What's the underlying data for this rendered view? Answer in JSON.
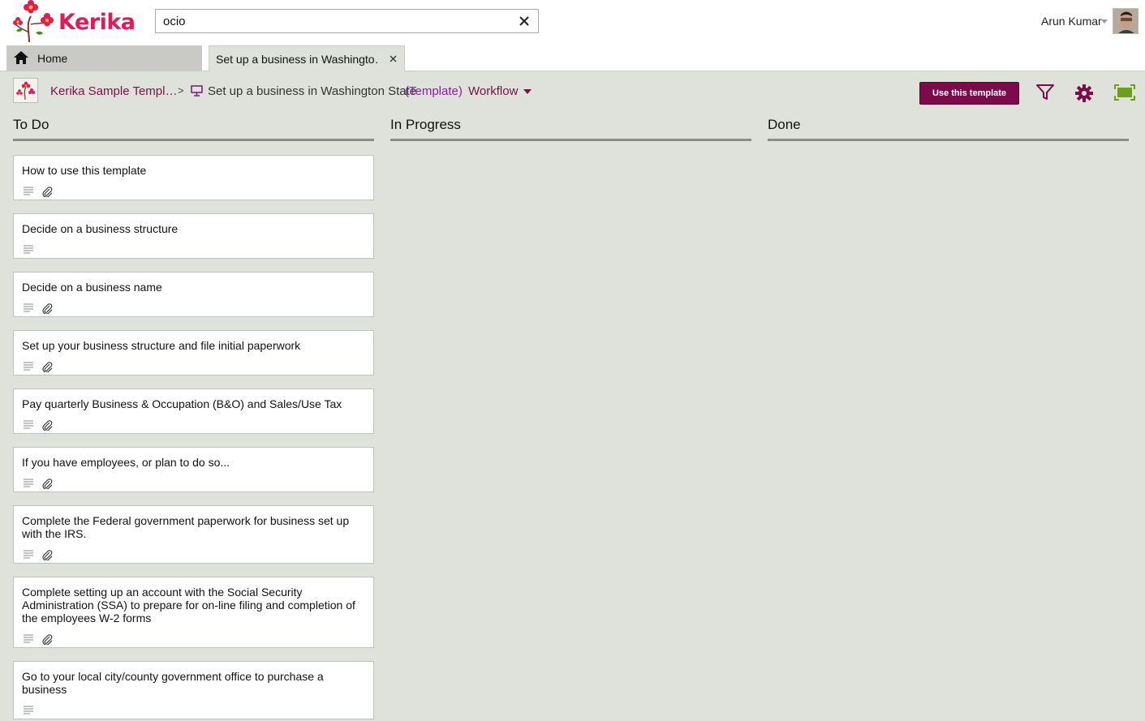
{
  "app": {
    "brand": "Kerika",
    "brand_color": "#e3195a",
    "accent": "#7d0a4b"
  },
  "search": {
    "value": "ocio",
    "placeholder": ""
  },
  "user": {
    "name": "Arun Kumar"
  },
  "tabs": [
    {
      "label": "Home",
      "icon": "home-icon"
    },
    {
      "label": "Set up a business in Washingto…",
      "icon": "close-icon"
    }
  ],
  "breadcrumb": {
    "project": "Kerika Sample Templ…",
    "separator": ">",
    "board": "Set up a business in Washington State",
    "tag": "(Template)",
    "view": "Workflow"
  },
  "toolbar": {
    "use_template_label": "Use this template"
  },
  "columns": [
    {
      "title": "To Do"
    },
    {
      "title": "In Progress"
    },
    {
      "title": "Done"
    }
  ],
  "cards": [
    {
      "title": "How to use this template",
      "has_description": true,
      "has_attachment": true
    },
    {
      "title": "Decide on a business structure",
      "has_description": true,
      "has_attachment": false
    },
    {
      "title": "Decide on a business name",
      "has_description": true,
      "has_attachment": true
    },
    {
      "title": "Set up your business structure and file initial paperwork",
      "has_description": true,
      "has_attachment": true
    },
    {
      "title": "Pay quarterly Business & Occupation (B&O) and Sales/Use Tax",
      "has_description": true,
      "has_attachment": true
    },
    {
      "title": "If you have employees, or plan to do so...",
      "has_description": true,
      "has_attachment": true
    },
    {
      "title": "Complete the Federal government paperwork for business set up with the IRS.",
      "has_description": true,
      "has_attachment": true
    },
    {
      "title": "Complete setting up an account with the Social Security Administration (SSA) to prepare for on-line filing and completion of the employees W-2 forms",
      "has_description": true,
      "has_attachment": true
    },
    {
      "title": "Go to your local city/county government office to purchase a business",
      "has_description": true,
      "has_attachment": false
    }
  ]
}
